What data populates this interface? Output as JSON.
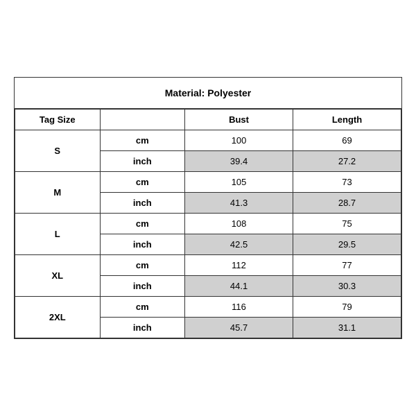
{
  "title": "Material: Polyester",
  "headers": {
    "tag_size": "Tag Size",
    "bust": "Bust",
    "length": "Length"
  },
  "sizes": [
    {
      "tag": "S",
      "cm_bust": "100",
      "cm_length": "69",
      "inch_bust": "39.4",
      "inch_length": "27.2"
    },
    {
      "tag": "M",
      "cm_bust": "105",
      "cm_length": "73",
      "inch_bust": "41.3",
      "inch_length": "28.7"
    },
    {
      "tag": "L",
      "cm_bust": "108",
      "cm_length": "75",
      "inch_bust": "42.5",
      "inch_length": "29.5"
    },
    {
      "tag": "XL",
      "cm_bust": "112",
      "cm_length": "77",
      "inch_bust": "44.1",
      "inch_length": "30.3"
    },
    {
      "tag": "2XL",
      "cm_bust": "116",
      "cm_length": "79",
      "inch_bust": "45.7",
      "inch_length": "31.1"
    }
  ],
  "units": {
    "cm": "cm",
    "inch": "inch"
  }
}
